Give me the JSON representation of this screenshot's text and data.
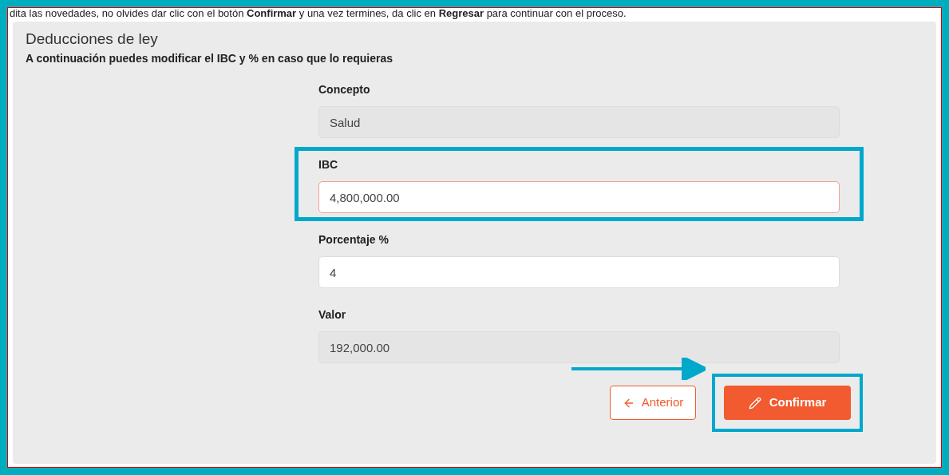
{
  "instruction": "dita las novedades, no olvides dar clic con el botón **Confirmar** y una vez termines, da clic en **Regresar** para continuar con el proceso.",
  "panel": {
    "title": "Deducciones de ley",
    "subtitle": "A continuación puedes modificar el IBC y % en caso que lo requieras"
  },
  "fields": [
    {
      "label": "Concepto",
      "value": "Salud",
      "disabled": true,
      "focused": false,
      "highlighted": false
    },
    {
      "label": "IBC",
      "value": "4,800,000.00",
      "disabled": false,
      "focused": true,
      "highlighted": true
    },
    {
      "label": "Porcentaje %",
      "value": "4",
      "disabled": false,
      "focused": false,
      "highlighted": false
    },
    {
      "label": "Valor",
      "value": "192,000.00",
      "disabled": true,
      "focused": false,
      "highlighted": false
    }
  ],
  "buttons": [
    {
      "kind": "back",
      "label": "Anterior",
      "highlighted": false
    },
    {
      "kind": "confirm",
      "label": "Confirmar",
      "highlighted": true
    }
  ]
}
